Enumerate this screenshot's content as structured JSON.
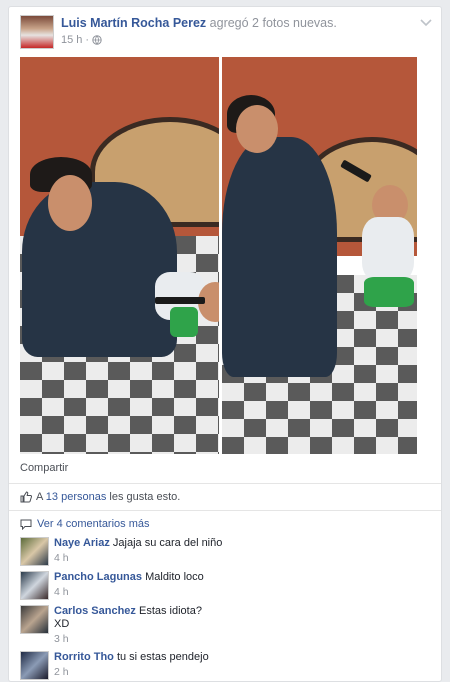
{
  "post": {
    "author": "Luis Martín Rocha Perez",
    "action": " agregó 2 fotos nuevas.",
    "time": "15 h",
    "separator": "·",
    "share_label": "Compartir"
  },
  "likes": {
    "prefix": "A ",
    "count_link": "13 personas",
    "suffix": " les gusta esto."
  },
  "more_comments_label": "Ver 4 comentarios más",
  "comments": [
    {
      "name": "Naye Ariaz",
      "text": "Jajaja su cara del niño",
      "text2": "",
      "time": "4 h"
    },
    {
      "name": "Pancho Lagunas",
      "text": "Maldito loco",
      "text2": "",
      "time": "4 h"
    },
    {
      "name": "Carlos Sanchez",
      "text": "Estas idiota?",
      "text2": "XD",
      "time": "3 h"
    },
    {
      "name": "Rorrito Tho",
      "text": "tu si estas pendejo",
      "text2": "",
      "time": "2 h"
    }
  ],
  "icons": {
    "chevron": "chevron-down-icon",
    "globe": "globe-icon",
    "like": "thumbs-up-icon",
    "comment": "speech-bubble-icon"
  },
  "colors": {
    "link": "#365899",
    "meta": "#90949c",
    "background": "#e9ebee"
  }
}
